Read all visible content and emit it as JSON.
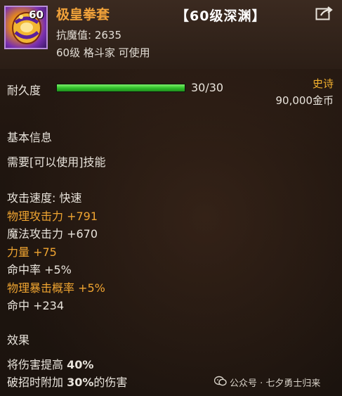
{
  "item": {
    "level_badge": "60",
    "name": "极皇拳套",
    "dungeon_tag": "【60级深渊】",
    "anti_magic": "抗魔值: 2635",
    "usable": "60级 格斗家 可使用"
  },
  "durability": {
    "label": "耐久度",
    "value_text": "30/30",
    "current": 30,
    "max": 30
  },
  "rarity": "史诗",
  "price": "90,000金币",
  "basic_info": {
    "title": "基本信息",
    "requirement": "需要[可以使用]技能"
  },
  "stats": [
    {
      "text": "攻击速度: 快速",
      "highlight": false
    },
    {
      "text": "物理攻击力 +791",
      "highlight": true
    },
    {
      "text": "魔法攻击力 +670",
      "highlight": false
    },
    {
      "text": "力量 +75",
      "highlight": true
    },
    {
      "text": "命中率 +5%",
      "highlight": false
    },
    {
      "text": "物理暴击概率 +5%",
      "highlight": true
    },
    {
      "text": "命中 +234",
      "highlight": false
    }
  ],
  "effects": {
    "title": "效果",
    "lines": [
      {
        "prefix": "将伤害提高 ",
        "value": "40%",
        "suffix": ""
      },
      {
        "prefix": "破招时附加 ",
        "value": "30%",
        "suffix": "的伤害"
      }
    ]
  },
  "watermark": "公众号 · 七夕勇士归来",
  "colors": {
    "item_name": "#f1a23a",
    "highlight_stat": "#f0a531",
    "rarity": "#f3b12e",
    "durability_bar": "#33c22d",
    "icon_border": "#b98dd8"
  },
  "icons": {
    "item": "gauntlet-icon",
    "share": "share-icon",
    "watermark": "wechat-icon"
  }
}
